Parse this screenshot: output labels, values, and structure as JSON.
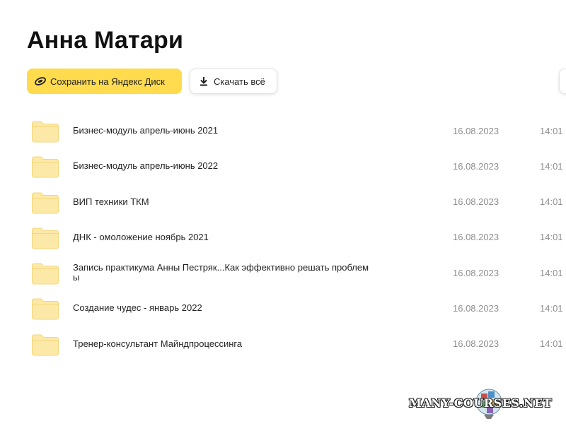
{
  "page": {
    "title": "Анна Матари"
  },
  "toolbar": {
    "save_label": "Сохранить на Яндекс Диск",
    "download_label": "Скачать всё"
  },
  "files": [
    {
      "name": "Бизнес-модуль апрель-июнь 2021",
      "date": "16.08.2023",
      "time": "14:01"
    },
    {
      "name": "Бизнес-модуль апрель-июнь 2022",
      "date": "16.08.2023",
      "time": "14:01"
    },
    {
      "name": "ВИП техники ТКМ",
      "date": "16.08.2023",
      "time": "14:01"
    },
    {
      "name": "ДНК - омоложение ноябрь 2021",
      "date": "16.08.2023",
      "time": "14:01"
    },
    {
      "name": "Запись практикума Анны Пестряк...Как эффективно решать проблем\nы",
      "date": "16.08.2023",
      "time": "14:01"
    },
    {
      "name": "Создание чудес - январь 2022",
      "date": "16.08.2023",
      "time": "14:01"
    },
    {
      "name": "Тренер-консультант Майндпроцессинга",
      "date": "16.08.2023",
      "time": "14:01"
    }
  ],
  "watermark": {
    "text": "MANY-COURSES.NET"
  },
  "colors": {
    "accent_yellow": "#ffdb4d",
    "folder_fill": "#fde9a7",
    "folder_stroke": "#f3d77b",
    "muted_text": "#8f8f8f"
  },
  "icons": {
    "save": "yandex-disk-icon",
    "download": "download-icon",
    "folder": "folder-icon"
  }
}
